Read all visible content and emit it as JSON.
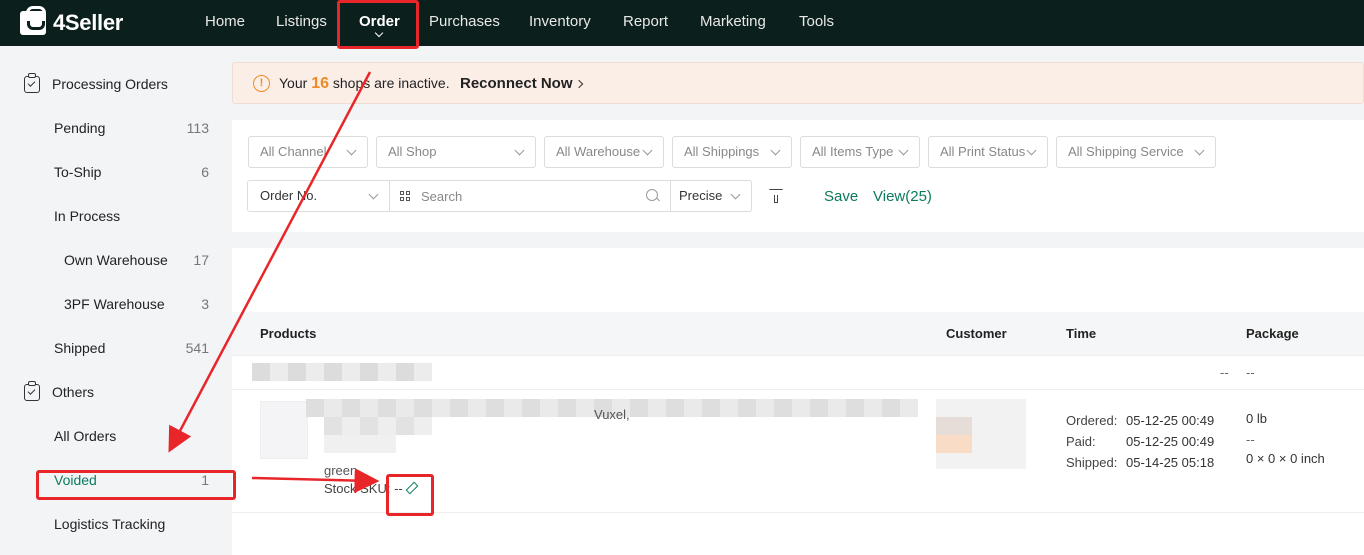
{
  "app": {
    "brand": "4Seller",
    "nav": [
      {
        "label": "Home"
      },
      {
        "label": "Listings"
      },
      {
        "label": "Order"
      },
      {
        "label": "Purchases"
      },
      {
        "label": "Inventory"
      },
      {
        "label": "Report"
      },
      {
        "label": "Marketing"
      },
      {
        "label": "Tools"
      }
    ]
  },
  "sidebar": {
    "groups": [
      {
        "label": "Processing Orders"
      },
      {
        "label": "Others"
      }
    ],
    "items": [
      {
        "label": "Pending",
        "count": "113"
      },
      {
        "label": "To-Ship",
        "count": "6"
      },
      {
        "label": "In Process",
        "count": ""
      },
      {
        "label": "Own Warehouse",
        "count": "17"
      },
      {
        "label": "3PF Warehouse",
        "count": "3"
      },
      {
        "label": "Shipped",
        "count": "541"
      },
      {
        "label": "All Orders",
        "count": ""
      },
      {
        "label": "Voided",
        "count": "1"
      },
      {
        "label": "Logistics Tracking",
        "count": ""
      }
    ]
  },
  "banner": {
    "prefix": "Your ",
    "count": "16",
    "suffix": " shops are inactive.",
    "link": "Reconnect Now"
  },
  "filters": {
    "selects": [
      {
        "label": "All Channel"
      },
      {
        "label": "All Shop"
      },
      {
        "label": "All Warehouse"
      },
      {
        "label": "All Shippings"
      },
      {
        "label": "All Items Type"
      },
      {
        "label": "All Print Status"
      },
      {
        "label": "All Shipping Service"
      }
    ],
    "search_field": "Order No.",
    "search_placeholder": "Search",
    "match_mode": "Precise",
    "save_label": "Save",
    "view_label": "View(25)"
  },
  "table": {
    "headers": {
      "products": "Products",
      "customer": "Customer",
      "time": "Time",
      "package": "Package"
    },
    "group_row": {
      "dash_1": "--",
      "dash_2": "--"
    },
    "order": {
      "product_text": "Vuxel,",
      "variant": "green",
      "stock_sku": "Stock SKU: --",
      "time": [
        {
          "label": "Ordered:",
          "value": "05-12-25 00:49"
        },
        {
          "label": "Paid:",
          "value": "05-12-25 00:49"
        },
        {
          "label": "Shipped:",
          "value": "05-14-25 05:18"
        }
      ],
      "package": {
        "weight": "0 lb",
        "dash": "--",
        "dimensions": "0 × 0 × 0 inch"
      }
    }
  },
  "colors": {
    "topbar": "#0b1f1c",
    "accent_green": "#0d7a5f",
    "warning_orange": "#f08a24",
    "annotation_red": "#e8262a"
  }
}
